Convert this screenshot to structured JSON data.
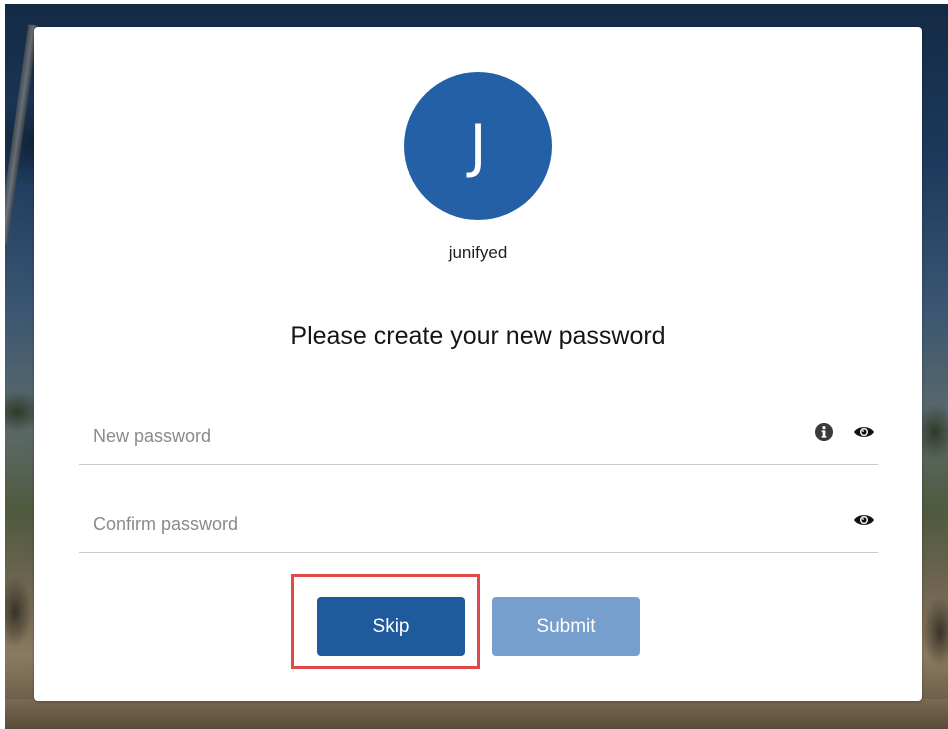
{
  "account": {
    "avatar_initial": "J",
    "username": "junifyed",
    "avatar_color": "#2360a5"
  },
  "form": {
    "heading": "Please create your new password",
    "new_password": {
      "placeholder": "New password",
      "value": "",
      "icons": [
        "info-icon",
        "eye-icon"
      ]
    },
    "confirm_password": {
      "placeholder": "Confirm password",
      "value": "",
      "icons": [
        "eye-icon"
      ]
    }
  },
  "actions": {
    "skip_label": "Skip",
    "submit_label": "Submit",
    "skip_color": "#1f5a9d",
    "submit_color": "#779fcd",
    "highlight_color": "#e04a4a",
    "highlighted": "Skip"
  }
}
